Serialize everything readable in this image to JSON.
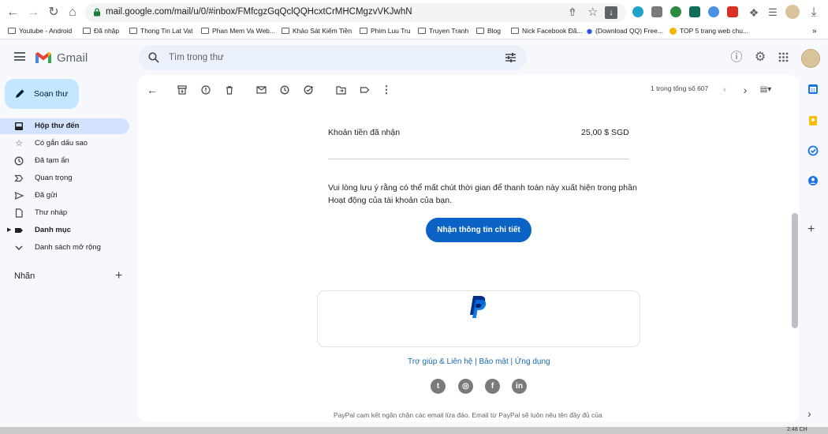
{
  "browser": {
    "url": "mail.google.com/mail/u/0/#inbox/FMfcgzGqQclQQHcxtCrMHCMgzvVKJwhN",
    "bookmarks": [
      "Youtube - Android",
      "Đã nhập",
      "Thong Tin Lat Vat",
      "Phan Mem Va Web...",
      "Khảo Sát Kiếm Tiền",
      "Phim Luu Tru",
      "Truyen Tranh",
      "Blog",
      "Nick Facebook Đã...",
      "(Download QQ) Free...",
      "TOP 5 trang web chu..."
    ],
    "overflow": "»"
  },
  "gmail": {
    "app_name": "Gmail",
    "search_placeholder": "Tìm trong thư",
    "compose_label": "Soạn thư"
  },
  "sidebar": {
    "items": [
      {
        "label": "Hộp thư đến",
        "icon": "inbox-icon"
      },
      {
        "label": "Có gắn dấu sao",
        "icon": "star-icon"
      },
      {
        "label": "Đã tạm ẩn",
        "icon": "clock-icon"
      },
      {
        "label": "Quan trọng",
        "icon": "important-icon"
      },
      {
        "label": "Đã gửi",
        "icon": "send-icon"
      },
      {
        "label": "Thư nháp",
        "icon": "draft-icon"
      },
      {
        "label": "Danh mục",
        "icon": "label-icon"
      },
      {
        "label": "Danh sách mở rộng",
        "icon": "chevron-down-icon"
      }
    ],
    "labels_heading": "Nhãn"
  },
  "toolbar": {
    "pagination": "1 trong tổng số 607"
  },
  "email": {
    "amount_label": "Khoản tiền đã nhận",
    "amount_value": "25,00 $ SGD",
    "notice": "Vui lòng lưu ý rằng có thể mất chút thời gian để thanh toán này xuất hiện trong phần Hoạt động của tài khoản của bạn.",
    "button_label": "Nhận thông tin chi tiết",
    "footer_links": "Trợ giúp & Liên hệ | Bảo mật | Ứng dụng",
    "footer_text": "PayPal cam kết ngăn chặn các email lừa đảo. Email từ PayPal sẽ luôn nêu tên đầy đủ của",
    "social": [
      "twitter-icon",
      "instagram-icon",
      "facebook-icon",
      "linkedin-icon"
    ]
  },
  "system": {
    "clock": "2:48 CH"
  },
  "colors": {
    "accent": "#0b63c5",
    "compose_bg": "#c2e7ff",
    "inbox_selected": "#d3e3fd"
  }
}
